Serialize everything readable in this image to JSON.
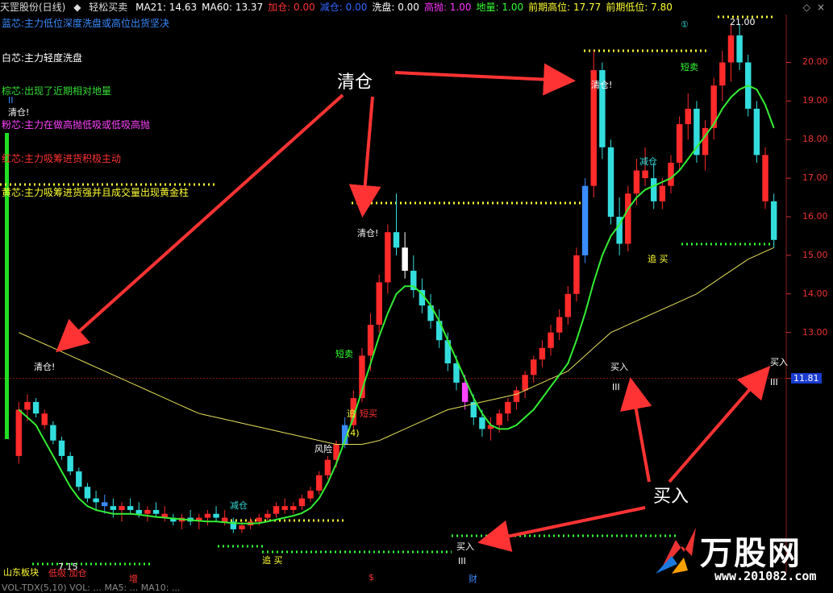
{
  "header": {
    "stock_name": "天罡股份(日线)",
    "indicator_name": "轻松买卖",
    "items": [
      {
        "label": "MA21: 14.63",
        "color": "#ffffff"
      },
      {
        "label": "MA60: 13.37",
        "color": "#ffffff"
      },
      {
        "label": "加仓: 0.00",
        "color": "#ff3333"
      },
      {
        "label": "减仓: 0.00",
        "color": "#3366ff"
      },
      {
        "label": "洗盘: 0.00",
        "color": "#ffffff"
      },
      {
        "label": "高抛: 1.00",
        "color": "#ff33ff"
      },
      {
        "label": "地量: 1.00",
        "color": "#33ff33"
      },
      {
        "label": "前期高位: 17.77",
        "color": "#ffff33"
      },
      {
        "label": "前期低位: 7.80",
        "color": "#ffff33"
      }
    ]
  },
  "legend": [
    {
      "text": "蓝芯:主力低位深度洗盘或高位出货坚决",
      "color": "#3a8cff"
    },
    {
      "text": "白芯:主力轻度洗盘",
      "color": "#ffffff"
    },
    {
      "text": "棕芯:出现了近期相对地量",
      "color": "#33dd33"
    },
    {
      "text": "粉芯:主力在做高抛低吸或低吸高抛",
      "color": "#ff44ff"
    },
    {
      "text": "红芯:主力吸筹进货积极主动",
      "color": "#ff3333"
    },
    {
      "text": "黄芯:主力吸筹进货强并且成交量出现黄金柱",
      "color": "#ffff33"
    }
  ],
  "left_markers": {
    "roman": "II",
    "qingcang": "清仓!"
  },
  "annotations": {
    "qingcang": "清仓!",
    "duanmai": "短卖",
    "zhui": "追",
    "maimai_short": "短买",
    "circled4": "(4)",
    "fengxian": "风险",
    "jiancang": "减仓",
    "zhui_mai": "追 买",
    "mairu": "买入",
    "roman3": "III",
    "circled1": "①",
    "top_price": "21.00",
    "bottom_left_text": "山东板块",
    "bottom_left_price": "7.15",
    "bottom_left_tag": "低吸 加仓"
  },
  "big_labels": {
    "qingcang": "清仓",
    "mairu": "买入"
  },
  "axis": {
    "ticks": [
      "20.00",
      "19.00",
      "18.00",
      "17.00",
      "16.00",
      "15.00",
      "14.00",
      "13.00",
      "11.81"
    ]
  },
  "bottom_bar": {
    "zeng": "增",
    "dollar": "$",
    "cai": "财",
    "indicator_text": "VOL-TDX(5,10)  VOL: ... MA5: ... MA10: ..."
  },
  "logo": {
    "brand": "万股网",
    "url": "www.201082.com"
  },
  "chart_data": {
    "type": "candlestick",
    "price_range": [
      11.0,
      21.2
    ],
    "current_price": 11.81,
    "candles": [
      [
        9.8,
        11.2,
        9.6,
        11.0
      ],
      [
        11.0,
        11.4,
        10.7,
        11.2
      ],
      [
        11.2,
        11.3,
        10.8,
        10.9
      ],
      [
        10.9,
        11.0,
        10.5,
        10.6
      ],
      [
        10.6,
        10.7,
        10.1,
        10.2
      ],
      [
        10.2,
        10.3,
        9.7,
        9.8
      ],
      [
        9.8,
        9.9,
        9.3,
        9.4
      ],
      [
        9.4,
        9.5,
        8.9,
        9.0
      ],
      [
        9.0,
        9.1,
        8.6,
        8.7
      ],
      [
        8.7,
        8.9,
        8.4,
        8.6
      ],
      [
        8.6,
        8.8,
        8.3,
        8.5
      ],
      [
        8.5,
        8.7,
        8.2,
        8.4
      ],
      [
        8.4,
        8.6,
        8.1,
        8.5
      ],
      [
        8.5,
        8.7,
        8.3,
        8.4
      ],
      [
        8.4,
        8.6,
        8.2,
        8.3
      ],
      [
        8.3,
        8.5,
        8.1,
        8.4
      ],
      [
        8.4,
        8.6,
        8.2,
        8.3
      ],
      [
        8.3,
        8.5,
        8.1,
        8.2
      ],
      [
        8.2,
        8.3,
        8.0,
        8.1
      ],
      [
        8.1,
        8.3,
        7.9,
        8.2
      ],
      [
        8.2,
        8.4,
        8.0,
        8.1
      ],
      [
        8.1,
        8.3,
        7.9,
        8.2
      ],
      [
        8.2,
        8.4,
        8.0,
        8.3
      ],
      [
        8.3,
        8.5,
        8.1,
        8.2
      ],
      [
        8.2,
        8.4,
        8.0,
        8.1
      ],
      [
        8.1,
        8.2,
        7.8,
        7.9
      ],
      [
        7.9,
        8.1,
        7.8,
        8.0
      ],
      [
        8.0,
        8.2,
        7.9,
        8.1
      ],
      [
        8.1,
        8.3,
        8.0,
        8.2
      ],
      [
        8.2,
        8.4,
        8.1,
        8.3
      ],
      [
        8.3,
        8.6,
        8.2,
        8.5
      ],
      [
        8.5,
        8.7,
        8.3,
        8.4
      ],
      [
        8.4,
        8.6,
        8.3,
        8.5
      ],
      [
        8.5,
        8.8,
        8.4,
        8.7
      ],
      [
        8.7,
        9.0,
        8.6,
        8.9
      ],
      [
        8.9,
        9.4,
        8.8,
        9.3
      ],
      [
        9.3,
        9.8,
        9.2,
        9.7
      ],
      [
        9.7,
        10.2,
        9.5,
        10.1
      ],
      [
        10.1,
        10.8,
        10.0,
        10.6
      ],
      [
        10.6,
        11.5,
        10.5,
        11.3
      ],
      [
        11.3,
        12.6,
        11.2,
        12.4
      ],
      [
        12.4,
        13.5,
        12.0,
        13.2
      ],
      [
        13.2,
        14.5,
        13.0,
        14.3
      ],
      [
        14.3,
        15.8,
        14.0,
        15.6
      ],
      [
        15.6,
        16.6,
        15.0,
        15.2
      ],
      [
        15.2,
        15.6,
        14.4,
        14.6
      ],
      [
        14.6,
        15.0,
        13.9,
        14.1
      ],
      [
        14.1,
        14.4,
        13.5,
        13.7
      ],
      [
        13.7,
        14.0,
        13.1,
        13.3
      ],
      [
        13.3,
        13.6,
        12.6,
        12.8
      ],
      [
        12.8,
        13.0,
        12.0,
        12.2
      ],
      [
        12.2,
        12.4,
        11.5,
        11.7
      ],
      [
        11.7,
        11.9,
        11.0,
        11.2
      ],
      [
        11.2,
        11.4,
        10.6,
        10.8
      ],
      [
        10.8,
        11.0,
        10.3,
        10.5
      ],
      [
        10.5,
        10.8,
        10.2,
        10.6
      ],
      [
        10.6,
        11.0,
        10.4,
        10.9
      ],
      [
        10.9,
        11.3,
        10.7,
        11.2
      ],
      [
        11.2,
        11.6,
        11.0,
        11.5
      ],
      [
        11.5,
        12.0,
        11.3,
        11.9
      ],
      [
        11.9,
        12.4,
        11.7,
        12.3
      ],
      [
        12.3,
        12.8,
        12.1,
        12.6
      ],
      [
        12.6,
        13.2,
        12.4,
        13.0
      ],
      [
        13.0,
        13.6,
        12.8,
        13.4
      ],
      [
        13.4,
        14.2,
        13.2,
        14.0
      ],
      [
        14.0,
        15.2,
        13.8,
        15.0
      ],
      [
        15.0,
        17.0,
        14.8,
        16.8
      ],
      [
        16.8,
        20.3,
        16.5,
        19.8
      ],
      [
        19.8,
        20.0,
        17.5,
        17.8
      ],
      [
        17.8,
        18.0,
        15.8,
        16.0
      ],
      [
        16.0,
        16.5,
        15.0,
        15.3
      ],
      [
        15.3,
        16.8,
        15.1,
        16.6
      ],
      [
        16.6,
        17.5,
        16.3,
        17.2
      ],
      [
        17.2,
        17.8,
        16.8,
        17.0
      ],
      [
        17.0,
        17.4,
        16.2,
        16.4
      ],
      [
        16.4,
        17.0,
        16.2,
        16.8
      ],
      [
        16.8,
        17.6,
        16.6,
        17.4
      ],
      [
        17.4,
        18.6,
        17.2,
        18.4
      ],
      [
        18.4,
        19.2,
        18.0,
        18.8
      ],
      [
        18.8,
        19.0,
        17.4,
        17.6
      ],
      [
        17.6,
        18.5,
        17.2,
        18.3
      ],
      [
        18.3,
        19.6,
        18.0,
        19.4
      ],
      [
        19.4,
        20.3,
        19.0,
        20.0
      ],
      [
        20.0,
        21.0,
        19.5,
        20.7
      ],
      [
        20.7,
        21.0,
        19.8,
        20.0
      ],
      [
        20.0,
        20.2,
        18.6,
        18.8
      ],
      [
        18.8,
        19.0,
        17.4,
        17.6
      ],
      [
        17.6,
        17.8,
        16.2,
        16.4
      ],
      [
        16.4,
        16.6,
        15.2,
        15.4
      ]
    ],
    "ma_green": [
      11.0,
      10.8,
      10.6,
      10.2,
      9.8,
      9.4,
      9.0,
      8.7,
      8.5,
      8.4,
      8.35,
      8.3,
      8.3,
      8.3,
      8.28,
      8.25,
      8.22,
      8.2,
      8.18,
      8.16,
      8.14,
      8.12,
      8.1,
      8.1,
      8.08,
      8.06,
      8.05,
      8.05,
      8.06,
      8.1,
      8.15,
      8.2,
      8.25,
      8.32,
      8.45,
      8.7,
      9.1,
      9.6,
      10.2,
      10.8,
      11.5,
      12.2,
      12.9,
      13.5,
      14.0,
      14.2,
      14.2,
      14.0,
      13.7,
      13.3,
      12.8,
      12.3,
      11.8,
      11.3,
      10.9,
      10.6,
      10.5,
      10.5,
      10.6,
      10.8,
      11.0,
      11.3,
      11.6,
      11.9,
      12.2,
      12.8,
      13.5,
      14.3,
      15.0,
      15.5,
      15.8,
      16.2,
      16.5,
      16.7,
      16.8,
      16.9,
      17.0,
      17.2,
      17.5,
      17.8,
      18.1,
      18.4,
      18.8,
      19.1,
      19.3,
      19.4,
      19.3,
      18.9,
      18.3
    ],
    "ma_yellow": [
      13.0,
      12.9,
      12.8,
      12.7,
      12.6,
      12.5,
      12.4,
      12.3,
      12.2,
      12.1,
      12.0,
      11.9,
      11.8,
      11.7,
      11.6,
      11.5,
      11.4,
      11.3,
      11.2,
      11.1,
      11.0,
      10.9,
      10.85,
      10.8,
      10.75,
      10.7,
      10.65,
      10.6,
      10.55,
      10.5,
      10.45,
      10.4,
      10.35,
      10.3,
      10.25,
      10.2,
      10.15,
      10.1,
      10.1,
      10.1,
      10.1,
      10.15,
      10.2,
      10.3,
      10.4,
      10.5,
      10.6,
      10.7,
      10.8,
      10.9,
      11.0,
      11.05,
      11.1,
      11.15,
      11.2,
      11.25,
      11.3,
      11.35,
      11.4,
      11.5,
      11.6,
      11.7,
      11.8,
      11.9,
      12.0,
      12.2,
      12.4,
      12.6,
      12.8,
      13.0,
      13.1,
      13.2,
      13.3,
      13.4,
      13.5,
      13.6,
      13.7,
      13.8,
      13.9,
      14.0,
      14.15,
      14.3,
      14.45,
      14.6,
      14.75,
      14.9,
      15.0,
      15.1,
      15.2
    ]
  }
}
